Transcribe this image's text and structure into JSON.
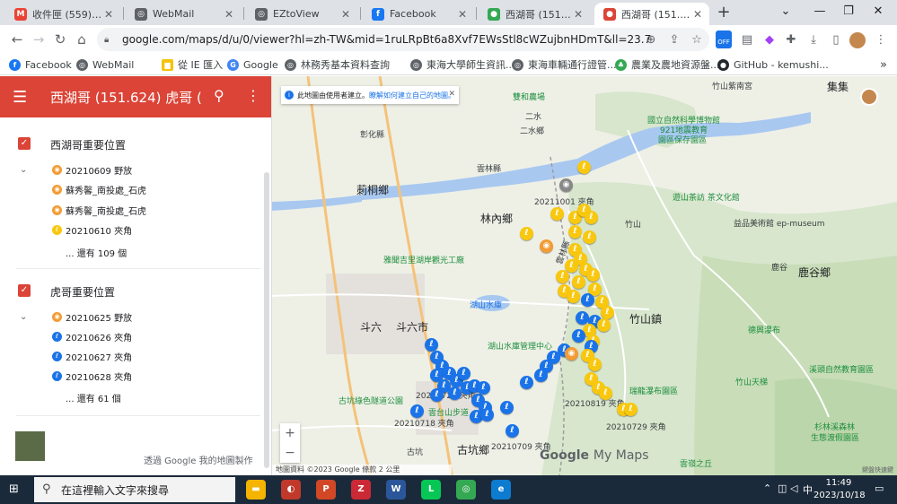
{
  "browser": {
    "tabs": [
      {
        "label": "收件匣 (559) - che",
        "icon": "gmail-icon",
        "color": "#ea4335",
        "glyph": "M"
      },
      {
        "label": "WebMail",
        "icon": "globe-icon",
        "color": "#5f6368",
        "glyph": "◎"
      },
      {
        "label": "EZtoView",
        "icon": "globe-icon",
        "color": "#5f6368",
        "glyph": "◎"
      },
      {
        "label": "Facebook",
        "icon": "facebook-icon",
        "color": "#1877f2",
        "glyph": "f"
      },
      {
        "label": "西湖哥 (151.624)",
        "icon": "maps-icon",
        "color": "#34a853",
        "glyph": "●"
      },
      {
        "label": "西湖哥 (151.624)",
        "icon": "mymaps-icon",
        "color": "#db4437",
        "glyph": "●"
      }
    ],
    "new_tab": "+",
    "window_controls": {
      "list": "⌄",
      "minimize": "—",
      "restore": "❐",
      "close": "✕"
    },
    "url": "google.com/maps/d/u/0/viewer?hl=zh-TW&mid=1ruLRpBt6a8Xvf7EWsStl8cWZujbnHDmT&ll=23.732131849...",
    "extension_badge": "OFF",
    "bookmarks": [
      {
        "label": "Facebook",
        "color": "#1877f2",
        "glyph": "f"
      },
      {
        "label": "WebMail",
        "color": "#5f6368",
        "glyph": "◎"
      },
      {
        "label": "從 IE 匯入",
        "color": "#f4c20d",
        "glyph": "▆"
      },
      {
        "label": "Google",
        "color": "#4285f4",
        "glyph": "G"
      },
      {
        "label": "林務秀基本資料查詢",
        "color": "#5f6368",
        "glyph": "◎"
      },
      {
        "label": "東海大學師生資訊...",
        "color": "#5f6368",
        "glyph": "◎"
      },
      {
        "label": "東海車輛通行證管...",
        "color": "#5f6368",
        "glyph": "◎"
      },
      {
        "label": "農業及農地資源盤...",
        "color": "#34a853",
        "glyph": "♣"
      },
      {
        "label": "GitHub - kemushi...",
        "color": "#24292e",
        "glyph": "●"
      }
    ]
  },
  "panel": {
    "title": "西湖哥 (151.624) 虎哥 (15...",
    "layers": [
      {
        "name": "西湖哥重要位置",
        "items": [
          {
            "label": "20210609 野放",
            "color": "#f39c34",
            "glyph": "◉",
            "expandable": true
          },
          {
            "label": "蘇秀馨_南投處_石虎",
            "color": "#f39c34",
            "glyph": "◉",
            "expandable": false
          },
          {
            "label": "蘇秀馨_南投處_石虎",
            "color": "#f39c34",
            "glyph": "◉",
            "expandable": false
          },
          {
            "label": "20210610 夾角",
            "color": "#f9c80e",
            "glyph": "ℓ",
            "expandable": false
          }
        ],
        "more": "... 還有 109 個"
      },
      {
        "name": "虎哥重要位置",
        "items": [
          {
            "label": "20210625 野放",
            "color": "#f39c34",
            "glyph": "◉",
            "expandable": true
          },
          {
            "label": "20210626 夾角",
            "color": "#1a73e8",
            "glyph": "ℓ",
            "expandable": false
          },
          {
            "label": "20210627 夾角",
            "color": "#1a73e8",
            "glyph": "ℓ",
            "expandable": false
          },
          {
            "label": "20210628 夾角",
            "color": "#1a73e8",
            "glyph": "ℓ",
            "expandable": false
          }
        ],
        "more": "... 還有 61 個"
      }
    ],
    "footer": "透過 Google 我的地圖製作"
  },
  "map": {
    "notice_text": "此地圖由使用者建立。",
    "notice_link": "瞭解如何建立自己的地圖。",
    "labels": [
      {
        "text": "集集",
        "cls": "big"
      },
      {
        "text": "竹山紫南宮",
        "cls": ""
      },
      {
        "text": "國立自然科學博物館",
        "cls": "green"
      },
      {
        "text": "921地震教育",
        "cls": "green"
      },
      {
        "text": "園區保存園區",
        "cls": "green"
      },
      {
        "text": "彰化縣",
        "cls": ""
      },
      {
        "text": "雲林縣",
        "cls": ""
      },
      {
        "text": "莿桐鄉",
        "cls": "big"
      },
      {
        "text": "林內鄉",
        "cls": "big"
      },
      {
        "text": "竹山",
        "cls": ""
      },
      {
        "text": "竹山鎮",
        "cls": "big"
      },
      {
        "text": "遊山茶訪 茶文化館",
        "cls": "green"
      },
      {
        "text": "益品美術館 ep-museum",
        "cls": ""
      },
      {
        "text": "鹿谷",
        "cls": ""
      },
      {
        "text": "鹿谷鄉",
        "cls": "big"
      },
      {
        "text": "雅聞吉里湖岸觀光工廠",
        "cls": "green"
      },
      {
        "text": "湖山水庫",
        "cls": "blue"
      },
      {
        "text": "斗六",
        "cls": "big"
      },
      {
        "text": "斗六市",
        "cls": "big"
      },
      {
        "text": "湖山水庫管理中心",
        "cls": "green"
      },
      {
        "text": "德興瀑布",
        "cls": "green"
      },
      {
        "text": "溪頭自然教育園區",
        "cls": "green"
      },
      {
        "text": "瑞龍瀑布園區",
        "cls": "green"
      },
      {
        "text": "竹山天梯",
        "cls": "green"
      },
      {
        "text": "古坑綠色隧道公園",
        "cls": "green"
      },
      {
        "text": "雲台山步道",
        "cls": "green"
      },
      {
        "text": "古坑",
        "cls": ""
      },
      {
        "text": "古坑鄉",
        "cls": "big"
      },
      {
        "text": "杉林溪森林",
        "cls": "green"
      },
      {
        "text": "生態渡假園區",
        "cls": "green"
      },
      {
        "text": "雲嶺之丘",
        "cls": "green"
      },
      {
        "text": "二水",
        "cls": ""
      },
      {
        "text": "二水鄉",
        "cls": ""
      },
      {
        "text": "雙和農場",
        "cls": "green"
      },
      {
        "text": "20211001 夾角",
        "cls": ""
      },
      {
        "text": "20210720 夾角",
        "cls": ""
      },
      {
        "text": "20210718 夾角",
        "cls": ""
      },
      {
        "text": "20210709 夾角",
        "cls": ""
      },
      {
        "text": "20210729 夾角",
        "cls": ""
      },
      {
        "text": "20210819 夾角",
        "cls": ""
      },
      {
        "text": "雲林縣",
        "cls": ""
      }
    ],
    "zoom_in": "+",
    "zoom_out": "−",
    "attribution": "地圖資料 ©2023 Google  條款  2 公里",
    "logo": "Google",
    "logo_suffix": "My Maps",
    "corner": "鍵盤快速鍵"
  },
  "taskbar": {
    "search_placeholder": "在這裡輸入文字來搜尋",
    "apps": [
      {
        "name": "file-explorer-icon",
        "color": "#f4b400",
        "glyph": "▬"
      },
      {
        "name": "swirl-app-icon",
        "color": "#c0392b",
        "glyph": "◐"
      },
      {
        "name": "powerpoint-icon",
        "color": "#d24726",
        "glyph": "P"
      },
      {
        "name": "zotero-icon",
        "color": "#cc2936",
        "glyph": "Z"
      },
      {
        "name": "word-icon",
        "color": "#2b579a",
        "glyph": "W"
      },
      {
        "name": "line-icon",
        "color": "#06c755",
        "glyph": "L"
      },
      {
        "name": "chrome-icon",
        "color": "#34a853",
        "glyph": "◎"
      },
      {
        "name": "edge-icon",
        "color": "#0c7bd0",
        "glyph": "e"
      }
    ],
    "ime": "中",
    "time": "11:49",
    "date": "2023/10/18"
  }
}
